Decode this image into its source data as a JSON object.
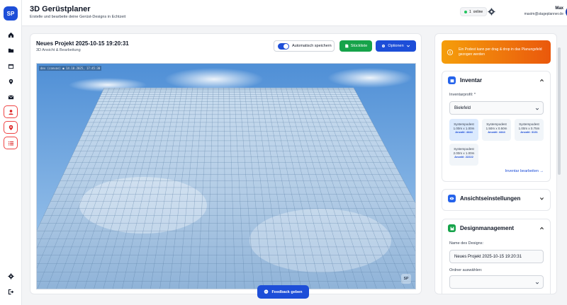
{
  "sidebar": {
    "logo": "SP",
    "items": [
      {
        "icon": "home-icon"
      },
      {
        "icon": "folder-icon"
      },
      {
        "icon": "calendar-icon"
      },
      {
        "icon": "location-icon"
      },
      {
        "icon": "mail-icon"
      },
      {
        "icon": "user-icon"
      },
      {
        "icon": "map-pin-icon"
      },
      {
        "icon": "list-icon"
      }
    ],
    "bottom": [
      {
        "icon": "settings-icon"
      },
      {
        "icon": "logout-icon"
      }
    ]
  },
  "header": {
    "title": "3D Gerüstplaner",
    "subtitle": "Erstelle und bearbeite deine Gerüst-Designs in Echtzeit",
    "online_count": "1",
    "online_label": "online",
    "user_name": "Max",
    "user_email": "maxim@stageplanner.de",
    "avatar": "M"
  },
  "main": {
    "project_title": "Neues Projekt 2025-10-15 19:20:31",
    "project_subtitle": "3D Ansicht & Bearbeitung",
    "autosave_label": "Automatisch speichern",
    "autosave_on": true,
    "stueckliste_label": "Stückliste",
    "options_label": "Optionen",
    "viewport_stamp": "dev (convas) ● 14.10.2025, 17:45:30",
    "viewport_badge": "SP"
  },
  "right": {
    "hint": "Ein Podest kann per drag & drop in das Planungsfeld gezogen werden",
    "inventar": {
      "title": "Inventar",
      "profile_label": "Inventarprofil: *",
      "profile_value": "Bielefeld",
      "pods": [
        {
          "name": "Systempodest",
          "dim": "1.00m x 1.00m",
          "count": "Anzahl: 4444",
          "selected": true
        },
        {
          "name": "Systempodest",
          "dim": "1.50m x 0.50m",
          "count": "Anzahl: 4444",
          "selected": false
        },
        {
          "name": "Systempodest",
          "dim": "1.00m x 0.75m",
          "count": "Anzahl: 3131",
          "selected": false
        },
        {
          "name": "Systempodest",
          "dim": "2.00m x 1.00m",
          "count": "Anzahl: 22222",
          "selected": false
        }
      ],
      "edit_link": "Inventar bearbeiten →"
    },
    "ansicht": {
      "title": "Ansichtseinstellungen"
    },
    "design": {
      "title": "Designmanagement",
      "name_label": "Name des Designs:",
      "name_value": "Neues Projekt 2025-10-15 19:20:31",
      "folder_label": "Ordner auswählen:",
      "folder_value": ""
    }
  },
  "feedback_label": "Feedback geben",
  "colors": {
    "accent": "#1d4ed8",
    "green": "#16a34a",
    "orange": "#f59e0b",
    "danger": "#ef4444"
  }
}
